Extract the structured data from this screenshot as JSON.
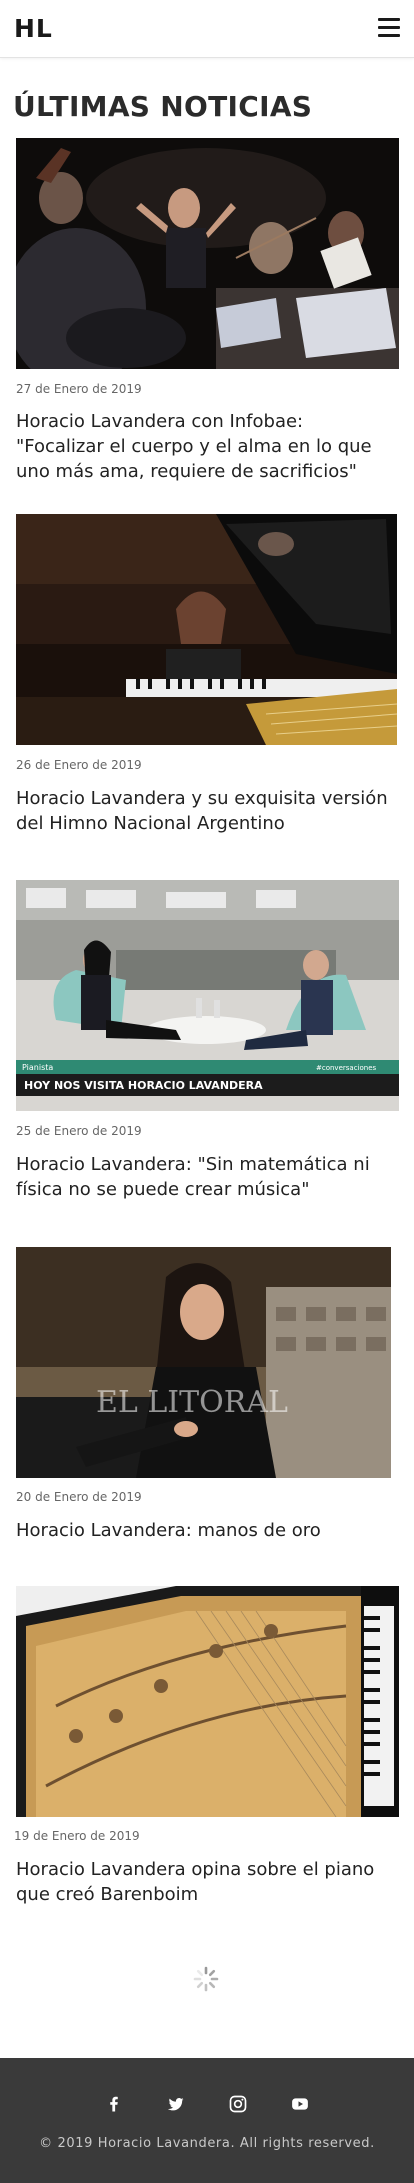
{
  "header": {
    "logo": "HL",
    "menu_icon": "hamburger-menu-icon"
  },
  "section_title": "ÚLTIMAS NOTICIAS",
  "articles": [
    {
      "date": "27 de Enero de 2019",
      "title": "Horacio Lavandera con Infobae: \"Focalizar el cuerpo y el alma en lo que uno más ama, requiere de sacrificios\""
    },
    {
      "date": "26 de Enero de 2019",
      "title": "Horacio Lavandera y su exquisita versión del Himno Nacional Argentino"
    },
    {
      "date": "25 de Enero de 2019",
      "title": "Horacio Lavandera: \"Sin matemática ni física no se puede crear música\"",
      "image_caption_small": "Pianista",
      "image_caption": "HOY NOS VISITA HORACIO LAVANDERA",
      "image_tag": "#conversaciones"
    },
    {
      "date": "20 de Enero de 2019",
      "title": "Horacio Lavandera: manos de oro",
      "image_watermark": "EL LITORAL"
    },
    {
      "date": "19 de Enero de 2019",
      "title": "Horacio Lavandera opina sobre el piano que creó Barenboim"
    }
  ],
  "footer": {
    "social_icons": [
      "facebook-icon",
      "twitter-icon",
      "instagram-icon",
      "youtube-icon"
    ],
    "copyright": "© 2019 Horacio Lavandera. All rights reserved."
  },
  "colors": {
    "footer_bg": "#3a3a3a",
    "text": "#222222",
    "date": "#666666"
  }
}
